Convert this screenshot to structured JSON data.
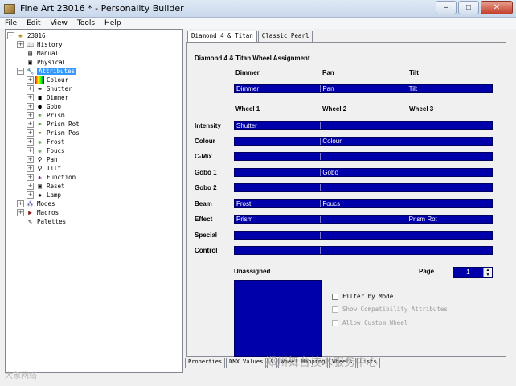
{
  "window": {
    "title": "Fine Art 23016 * - Personality Builder",
    "buttons": [
      "–",
      "□",
      "✕"
    ]
  },
  "menu": [
    "File",
    "Edit",
    "View",
    "Tools",
    "Help"
  ],
  "tree": {
    "root": "23016",
    "items": [
      {
        "label": "History",
        "icon": "book-icon"
      },
      {
        "label": "Manual",
        "icon": "manual-icon"
      },
      {
        "label": "Physical",
        "icon": "physical-icon"
      },
      {
        "label": "Attributes",
        "icon": "wrench-icon",
        "selected": true
      },
      {
        "label": "Colour",
        "icon": "colour-icon"
      },
      {
        "label": "Shutter",
        "icon": "shutter-icon"
      },
      {
        "label": "Dimmer",
        "icon": "dimmer-icon"
      },
      {
        "label": "Gobo",
        "icon": "gobo-icon"
      },
      {
        "label": "Prism",
        "icon": "prism-icon"
      },
      {
        "label": "Prism Rot",
        "icon": "prism-rot-icon"
      },
      {
        "label": "Prism Pos",
        "icon": "prism-pos-icon"
      },
      {
        "label": "Frost",
        "icon": "frost-icon"
      },
      {
        "label": "Foucs",
        "icon": "focus-icon"
      },
      {
        "label": "Pan",
        "icon": "pan-icon"
      },
      {
        "label": "Tilt",
        "icon": "tilt-icon"
      },
      {
        "label": "Function",
        "icon": "function-icon"
      },
      {
        "label": "Reset",
        "icon": "reset-icon"
      },
      {
        "label": "Lamp",
        "icon": "lamp-icon"
      },
      {
        "label": "Modes",
        "icon": "modes-icon"
      },
      {
        "label": "Macros",
        "icon": "macros-icon"
      },
      {
        "label": "Palettes",
        "icon": "palettes-icon"
      }
    ]
  },
  "tabs": [
    "Diamond 4 & Titan",
    "Classic Pearl"
  ],
  "panel": {
    "title": "Diamond 4 & Titan Wheel Assignment",
    "top_headers": [
      "Dimmer",
      "Pan",
      "Tilt"
    ],
    "top_bar": [
      "Dimmer",
      "Pan",
      "Tilt"
    ],
    "wheel_headers": [
      "Wheel 1",
      "Wheel 2",
      "Wheel 3"
    ],
    "rows": [
      {
        "label": "Intensity",
        "cells": [
          "Shutter",
          "",
          ""
        ]
      },
      {
        "label": "Colour",
        "cells": [
          "",
          "Colour",
          ""
        ]
      },
      {
        "label": "C-Mix",
        "cells": [
          "",
          "",
          ""
        ]
      },
      {
        "label": "Gobo 1",
        "cells": [
          "",
          "Gobo",
          ""
        ]
      },
      {
        "label": "Gobo 2",
        "cells": [
          "",
          "",
          ""
        ]
      },
      {
        "label": "Beam",
        "cells": [
          "Frost",
          "Foucs",
          ""
        ]
      },
      {
        "label": "Effect",
        "cells": [
          "Prism",
          "",
          "Prism Rot"
        ]
      },
      {
        "label": "Special",
        "cells": [
          "",
          "",
          ""
        ]
      },
      {
        "label": "Control",
        "cells": [
          "",
          "",
          ""
        ]
      }
    ],
    "unassigned_label": "Unassigned",
    "page_label": "Page",
    "page_value": "1",
    "checks": [
      {
        "label": "Filter by Mode:",
        "enabled": true
      },
      {
        "label": "Show Compatibility Attributes",
        "enabled": false
      },
      {
        "label": "Allow Custom Wheel",
        "enabled": false
      }
    ]
  },
  "bottom_tabs": [
    "Properties",
    "DMX Values",
    "S",
    "Wheel Mapping",
    "Wheels",
    "Lists"
  ],
  "watermarks": [
    "大象网络",
    "郑州舞台技术服务中心"
  ],
  "colors": {
    "bar": "#0000aa",
    "selection": "#3399ff"
  }
}
